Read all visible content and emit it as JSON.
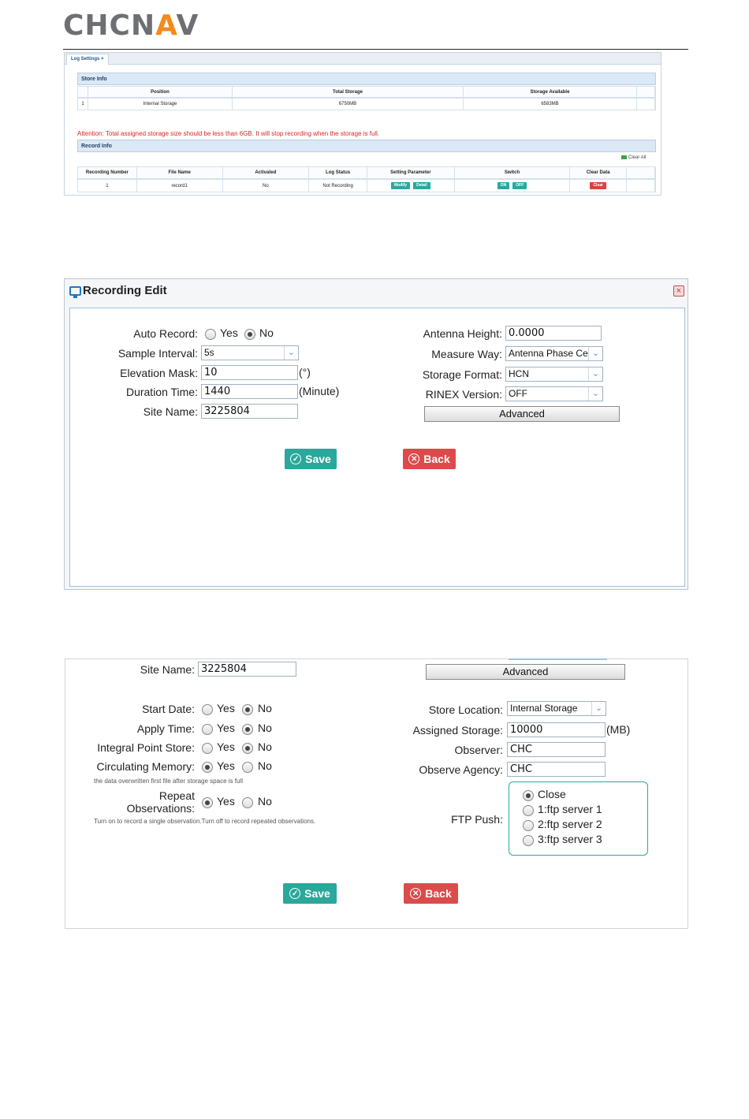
{
  "logo": "CHCNAV",
  "log_settings": {
    "tab": "Log Settings",
    "store_info": {
      "title": "Store Info",
      "columns": [
        "",
        "Position",
        "Total Storage",
        "Storage Available",
        ""
      ],
      "row": [
        "1",
        "Internal Storage",
        "6750MB",
        "6583MB",
        ""
      ]
    },
    "attention": "Attention: Total assigned storage size should be less than 6GB. It will stop recording when the storage is full.",
    "record_info": {
      "title": "Record Info",
      "clear_all": "Clear All",
      "columns": [
        "Recording Number",
        "File Name",
        "Activated",
        "Log Status",
        "Setting Parameter",
        "Switch",
        "Clear Data",
        ""
      ],
      "row": {
        "number": "1",
        "file": "record1",
        "activated": "No",
        "status": "Not Recording",
        "modify": "Modify",
        "detail": "Detail",
        "on": "ON",
        "off": "OFF",
        "clear": "Clear"
      }
    }
  },
  "recording_edit": {
    "title": "Recording Edit",
    "close": "×",
    "auto_record_label": "Auto Record:",
    "yes": "Yes",
    "no": "No",
    "sample_interval_label": "Sample Interval:",
    "sample_interval": "5s",
    "elevation_mask_label": "Elevation Mask:",
    "elevation_mask": "10",
    "elevation_unit": "(°)",
    "duration_time_label": "Duration Time:",
    "duration_time": "1440",
    "duration_unit": "(Minute)",
    "site_name_label": "Site Name:",
    "site_name": "3225804",
    "antenna_height_label": "Antenna Height:",
    "antenna_height": "0.0000",
    "measure_way_label": "Measure Way:",
    "measure_way": "Antenna Phase Ce",
    "storage_format_label": "Storage Format:",
    "storage_format": "HCN",
    "rinex_version_label": "RINEX Version:",
    "rinex_version": "OFF",
    "advanced": "Advanced",
    "save": "Save",
    "back": "Back"
  },
  "advanced_view": {
    "site_name_label": "Site Name:",
    "site_name": "3225804",
    "advanced": "Advanced",
    "start_date_label": "Start Date:",
    "apply_time_label": "Apply Time:",
    "integral_point_label": "Integral Point Store:",
    "circulating_memory_label": "Circulating Memory:",
    "circulating_note": "the data overwritten first file after storage space is full",
    "repeat_label_1": "Repeat",
    "repeat_label_2": "Observations:",
    "repeat_note": "Turn on to record a single observation.Turn off to record repeated observations.",
    "yes": "Yes",
    "no": "No",
    "store_location_label": "Store Location:",
    "store_location": "Internal Storage",
    "assigned_storage_label": "Assigned Storage:",
    "assigned_storage": "10000",
    "assigned_unit": "(MB)",
    "observer_label": "Observer:",
    "observer": "CHC",
    "observe_agency_label": "Observe Agency:",
    "observe_agency": "CHC",
    "ftp_push_label": "FTP Push:",
    "ftp_options": [
      "Close",
      "1:ftp server 1",
      "2:ftp server 2",
      "3:ftp server 3"
    ],
    "save": "Save",
    "back": "Back"
  }
}
